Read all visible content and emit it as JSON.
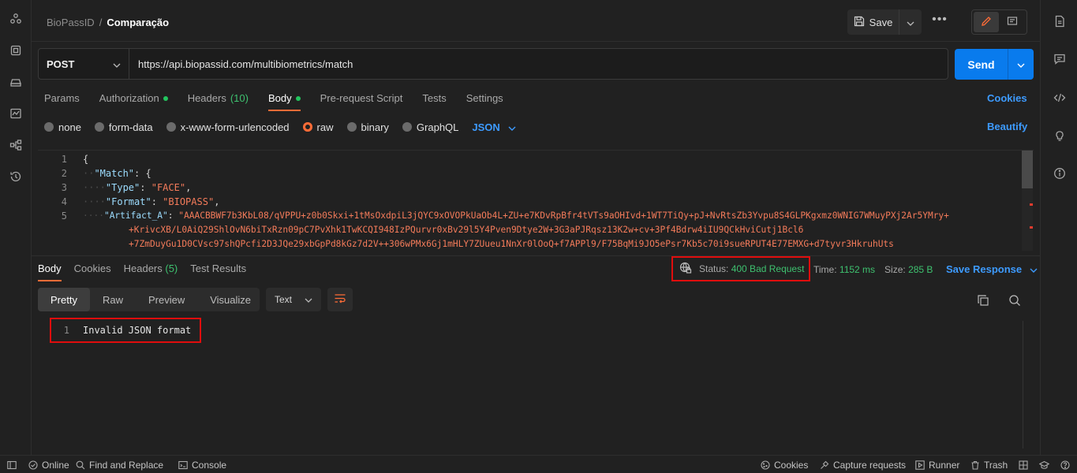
{
  "header": {
    "breadcrumb_parent": "BioPassID",
    "breadcrumb_sep": "/",
    "breadcrumb_current": "Comparação",
    "save_label": "Save",
    "more_label": "•••"
  },
  "request": {
    "method": "POST",
    "url": "https://api.biopassid.com/multibiometrics/match",
    "send_label": "Send",
    "tabs": [
      {
        "label": "Params"
      },
      {
        "label": "Authorization"
      },
      {
        "label": "Headers",
        "count": "(10)"
      },
      {
        "label": "Body"
      },
      {
        "label": "Pre-request Script"
      },
      {
        "label": "Tests"
      },
      {
        "label": "Settings"
      }
    ],
    "cookies_label": "Cookies",
    "body_types": [
      "none",
      "form-data",
      "x-www-form-urlencoded",
      "raw",
      "binary",
      "GraphQL"
    ],
    "body_format": "JSON",
    "beautify_label": "Beautify"
  },
  "editor": {
    "line_numbers": [
      "1",
      "2",
      "3",
      "4",
      "5",
      "",
      ""
    ],
    "lines": {
      "l1": "{",
      "l2_key": "\"Match\"",
      "l2_rest": ": {",
      "l3_key": "\"Type\"",
      "l3_val": "\"FACE\"",
      "l4_key": "\"Format\"",
      "l4_val": "\"BIOPASS\"",
      "l5_key": "\"Artifact_A\"",
      "l5_val": "\"AAACBBWF7b3KbL08/qVPPU+z0b0Skxi+1tMsOxdpiL3jQYC9xOVOPkUaOb4L+ZU+e7KDvRpBfr4tVTs9aOHIvd+1WT7TiQy+pJ+NvRtsZb3Yvpu8S4GLPKgxmz0WNIG7WMuyPXj2Ar5YMry+",
      "l5_wrap1": "+KrivcXB/L0AiQ29ShlOvN6biTxRzn09pC7PvXhk1TwKCQI948IzPQurvr0xBv29l5Y4Pven9Dtye2W+3G3aPJRqsz13K2w+cv+3Pf4Bdrw4iIU9QCkHviCutj1Bcl6",
      "l5_wrap2": "+7ZmDuyGu1D0CVsc97shQPcfi2D3JQe29xbGpPd8kGz7d2V++306wPMx6Gj1mHLY7ZUueu1NnXr0lOoQ+f7APPl9/F75BqMi9JO5ePsr7Kb5c70i9sueRPUT4E77EMXG+d7tyvr3HkruhUts"
    }
  },
  "response": {
    "tabs": [
      {
        "label": "Body"
      },
      {
        "label": "Cookies"
      },
      {
        "label": "Headers",
        "count": "(5)"
      },
      {
        "label": "Test Results"
      }
    ],
    "status_label": "Status:",
    "status_value": "400 Bad Request",
    "time_label": "Time:",
    "time_value": "1152 ms",
    "size_label": "Size:",
    "size_value": "285 B",
    "save_response_label": "Save Response",
    "view_modes": [
      "Pretty",
      "Raw",
      "Preview",
      "Visualize"
    ],
    "text_format": "Text",
    "body_line_number": "1",
    "body_text": "Invalid JSON format"
  },
  "footer": {
    "online": "Online",
    "find_replace": "Find and Replace",
    "console": "Console",
    "cookies": "Cookies",
    "capture": "Capture requests",
    "runner": "Runner",
    "trash": "Trash"
  },
  "colors": {
    "accent": "#ff6c37",
    "link": "#3d9bff",
    "send": "#097bed",
    "success": "#3ec16f",
    "highlight": "#e00d0d"
  }
}
